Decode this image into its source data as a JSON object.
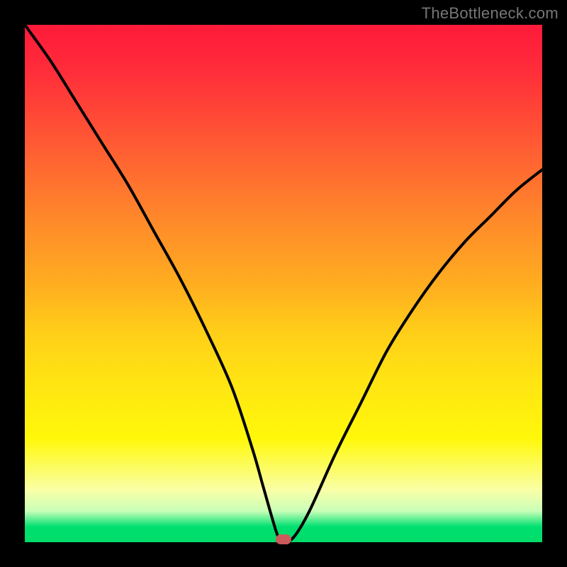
{
  "watermark": "TheBottleneck.com",
  "chart_data": {
    "type": "line",
    "title": "",
    "xlabel": "",
    "ylabel": "",
    "xlim": [
      0,
      100
    ],
    "ylim": [
      0,
      100
    ],
    "series": [
      {
        "name": "bottleneck-curve",
        "x": [
          0,
          5,
          10,
          15,
          20,
          25,
          30,
          35,
          40,
          44,
          46,
          48,
          49,
          50,
          52,
          55,
          60,
          65,
          70,
          75,
          80,
          85,
          90,
          95,
          100
        ],
        "values": [
          100,
          93,
          85,
          77,
          69,
          60,
          51,
          41,
          30,
          18,
          11,
          4,
          1,
          0,
          1,
          6,
          17,
          27,
          37,
          45,
          52,
          58,
          63,
          68,
          72
        ]
      }
    ],
    "marker": {
      "x": 50,
      "y": 0.5
    },
    "gradient_stops": [
      {
        "pos": 0,
        "color": "#ff1a3a"
      },
      {
        "pos": 50,
        "color": "#ffad20"
      },
      {
        "pos": 80,
        "color": "#fff80a"
      },
      {
        "pos": 97,
        "color": "#00e070"
      },
      {
        "pos": 100,
        "color": "#00dc6a"
      }
    ]
  }
}
